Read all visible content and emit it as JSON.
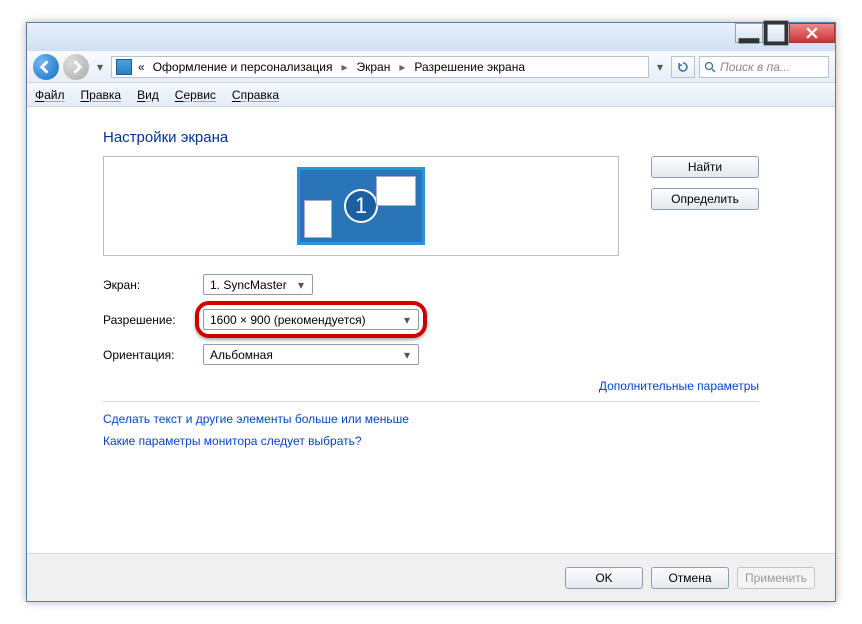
{
  "breadcrumb": {
    "prefix": "«",
    "p1": "Оформление и персонализация",
    "p2": "Экран",
    "p3": "Разрешение экрана"
  },
  "search": {
    "placeholder": "Поиск в па..."
  },
  "menu": {
    "file": "Файл",
    "edit": "Правка",
    "view": "Вид",
    "tools": "Сервис",
    "help": "Справка"
  },
  "heading": "Настройки экрана",
  "monitor_number": "1",
  "btn_find": "Найти",
  "btn_identify": "Определить",
  "lbl_screen": "Экран:",
  "val_screen": "1. SyncMaster",
  "lbl_resolution": "Разрешение:",
  "val_resolution": "1600 × 900 (рекомендуется)",
  "lbl_orientation": "Ориентация:",
  "val_orientation": "Альбомная",
  "link_advanced": "Дополнительные параметры",
  "link_text_size": "Сделать текст и другие элементы больше или меньше",
  "link_which": "Какие параметры монитора следует выбрать?",
  "btn_ok": "OK",
  "btn_cancel": "Отмена",
  "btn_apply": "Применить"
}
